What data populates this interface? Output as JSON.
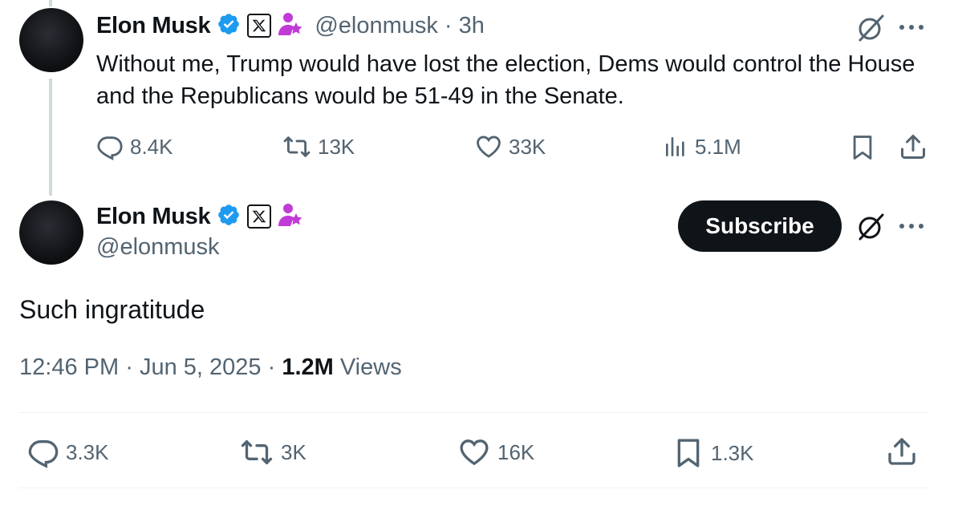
{
  "colors": {
    "text": "#0f1419",
    "muted": "#536471",
    "verified": "#1d9bf0",
    "affiliate": "#c13bd6",
    "divider": "#eff3f4"
  },
  "parent_tweet": {
    "author_name": "Elon Musk",
    "handle": "@elonmusk",
    "separator": "·",
    "time": "3h",
    "text": "Without me, Trump would have lost the election, Dems would control the House and the Republicans would be 51-49 in the Senate.",
    "replies": "8.4K",
    "reposts": "13K",
    "likes": "33K",
    "views": "5.1M",
    "icons": [
      "verified-badge-icon",
      "x-logo-icon",
      "affiliate-person-icon",
      "grok-icon",
      "more-icon",
      "reply-icon",
      "repost-icon",
      "like-icon",
      "views-icon",
      "bookmark-icon",
      "share-icon"
    ]
  },
  "main_tweet": {
    "author_name": "Elon Musk",
    "handle": "@elonmusk",
    "subscribe_label": "Subscribe",
    "text": "Such ingratitude",
    "time": "12:46 PM",
    "date": "Jun 5, 2025",
    "sep1": "·",
    "sep2": "·",
    "views_count": "1.2M",
    "views_label": "Views",
    "replies": "3.3K",
    "reposts": "3K",
    "likes": "16K",
    "bookmarks": "1.3K"
  }
}
